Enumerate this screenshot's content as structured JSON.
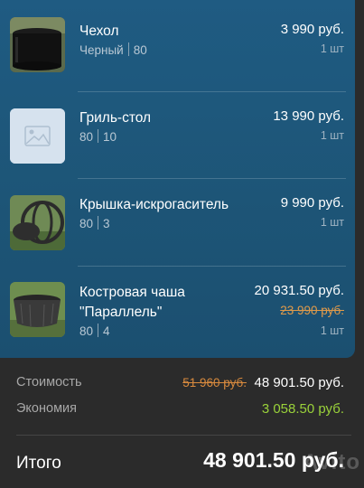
{
  "items": [
    {
      "name": "Чехол",
      "color": "Черный",
      "size": "80",
      "price": "3 990 руб.",
      "qty": "1 шт",
      "thumb": "cover-photo"
    },
    {
      "name": "Гриль-стол",
      "color": "80",
      "size": "10",
      "price": "13 990 руб.",
      "qty": "1 шт",
      "thumb": "image-placeholder-icon"
    },
    {
      "name": "Крышка-искрогаситель",
      "color": "80",
      "size": "3",
      "price": "9 990 руб.",
      "qty": "1 шт",
      "thumb": "spark-arrester-photo"
    },
    {
      "name": "Костровая чаша \"Параллель\"",
      "color": "80",
      "size": "4",
      "price": "20 931.50 руб.",
      "old_price": "23 990 руб.",
      "qty": "1 шт",
      "thumb": "fire-bowl-photo"
    }
  ],
  "summary": {
    "cost_label": "Стоимость",
    "cost_old": "51 960 руб.",
    "cost_value": "48 901.50 руб.",
    "savings_label": "Экономия",
    "savings_value": "3 058.50 руб.",
    "total_label": "Итого",
    "total_value": "48 901.50 руб."
  },
  "watermark": "Avito",
  "colors": {
    "panel": "#1f5b82",
    "old_price": "#e09a4a",
    "savings": "#9ad23a",
    "background": "#2b2b2b"
  }
}
